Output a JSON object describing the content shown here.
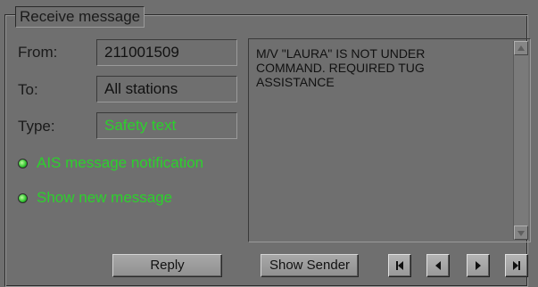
{
  "group_title": "Receive message",
  "fields": {
    "from": {
      "label": "From:",
      "value": "211001509"
    },
    "to": {
      "label": "To:",
      "value": "All stations"
    },
    "type": {
      "label": "Type:",
      "value": "Safety text"
    }
  },
  "options": [
    {
      "label": "AIS message notification"
    },
    {
      "label": "Show new message"
    }
  ],
  "message": "M/V \"LAURA\" IS NOT UNDER\nCOMMAND. REQUIRED TUG\nASSISTANCE",
  "buttons": {
    "reply": "Reply",
    "show_sender": "Show Sender"
  },
  "navigation": [
    "first-icon",
    "previous-icon",
    "next-icon",
    "last-icon"
  ],
  "colors": {
    "background": "#6f6f6f",
    "active_text": "#2cd02c"
  }
}
